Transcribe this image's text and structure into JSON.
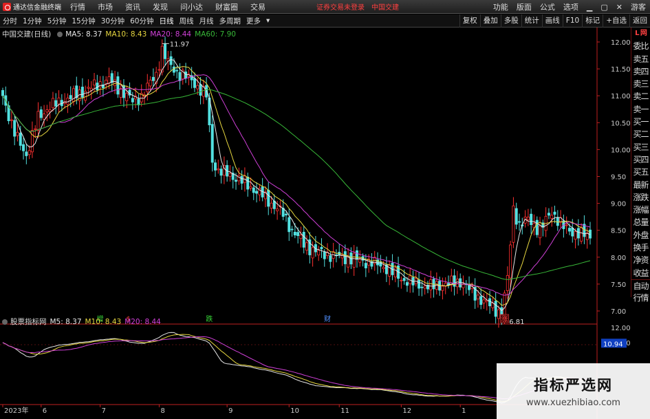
{
  "menubar": {
    "app_name": "通达信金融终端",
    "items": [
      "行情",
      "市场",
      "资讯",
      "发现",
      "问小达",
      "财富圈",
      "交易"
    ],
    "notice": "证券交易未登录",
    "stock": "中国交建",
    "right_items": [
      "功能",
      "版面",
      "公式",
      "选项",
      "游客"
    ]
  },
  "toolbar": {
    "periods": [
      "分时",
      "1分钟",
      "5分钟",
      "15分钟",
      "30分钟",
      "60分钟",
      "日线",
      "周线",
      "月线",
      "多周期",
      "更多"
    ],
    "active_period": "日线",
    "right_items": [
      "复权",
      "叠加",
      "多股",
      "统计",
      "画线",
      "F10",
      "标记",
      "+自选",
      "返回"
    ]
  },
  "legend": {
    "title": "中国交建(日线)",
    "ma5_label": "MA5: 8.37",
    "ma10_label": "MA10: 8.43",
    "ma20_label": "MA20: 8.44",
    "ma60_label": "MA60: 7.90"
  },
  "sub_legend": {
    "title": "股票指标网",
    "m5": "M5: 8.37",
    "m10": "M10: 8.43",
    "m20": "M20: 8.44"
  },
  "right_panel": [
    "L 网",
    "委比",
    "卖五",
    "卖四",
    "卖三",
    "卖二",
    "卖一",
    "买一",
    "买二",
    "买三",
    "买四",
    "买五",
    "最新",
    "涨跌",
    "涨幅",
    "总量",
    "外盘",
    "换手",
    "净资",
    "收益",
    "自动",
    "行情"
  ],
  "watermark": {
    "cn": "指标严选网",
    "url": "www.xuezhibiao.com"
  },
  "colors": {
    "up": "#ff3030",
    "down": "#52e0e0",
    "ma5": "#e8e8e8",
    "ma10": "#e8d840",
    "ma20": "#d040d8",
    "ma60": "#38b838",
    "axis": "#c02020"
  },
  "chart_data": {
    "type": "candlestick",
    "y_ticks": [
      "12.00",
      "11.50",
      "11.00",
      "10.50",
      "10.00",
      "9.50",
      "9.00",
      "8.50",
      "8.00",
      "7.50",
      "7.00"
    ],
    "sub_y_ticks": [
      "12.00",
      "11.00"
    ],
    "sub_value_box": "10.94",
    "x_labels": [
      {
        "text": "2023年",
        "i": 0
      },
      {
        "text": "6",
        "i": 13
      },
      {
        "text": "7",
        "i": 33
      },
      {
        "text": "8",
        "i": 53
      },
      {
        "text": "9",
        "i": 76
      },
      {
        "text": "10",
        "i": 97
      },
      {
        "text": "11",
        "i": 114
      },
      {
        "text": "12",
        "i": 135
      },
      {
        "text": "1",
        "i": 155
      }
    ],
    "annotations": {
      "high": "11.97",
      "low": "6.81"
    },
    "event_marks": [
      {
        "text": "增",
        "i": 33,
        "color": "#38d838"
      },
      {
        "text": "$",
        "i": 43,
        "color": "#ff4040"
      },
      {
        "text": "跌",
        "i": 70,
        "color": "#38d838"
      },
      {
        "text": "财",
        "i": 110,
        "color": "#5090ff"
      },
      {
        "text": "涨",
        "i": 170,
        "color": "#ff4040",
        "boxed": true
      }
    ],
    "anchors": [
      [
        0,
        11.0
      ],
      [
        4,
        10.3
      ],
      [
        8,
        9.9
      ],
      [
        12,
        10.6
      ],
      [
        16,
        10.8
      ],
      [
        20,
        10.9
      ],
      [
        24,
        11.0
      ],
      [
        28,
        11.1
      ],
      [
        32,
        11.2
      ],
      [
        36,
        11.3
      ],
      [
        40,
        11.1
      ],
      [
        44,
        10.9
      ],
      [
        47,
        11.0
      ],
      [
        52,
        11.4
      ],
      [
        54,
        11.85
      ],
      [
        56,
        11.6
      ],
      [
        60,
        11.4
      ],
      [
        64,
        11.3
      ],
      [
        67,
        11.1
      ],
      [
        69,
        11.0
      ],
      [
        71,
        9.8
      ],
      [
        73,
        9.6
      ],
      [
        76,
        9.55
      ],
      [
        80,
        9.45
      ],
      [
        84,
        9.3
      ],
      [
        88,
        9.15
      ],
      [
        92,
        8.95
      ],
      [
        95,
        8.8
      ],
      [
        98,
        8.5
      ],
      [
        102,
        8.25
      ],
      [
        106,
        8.1
      ],
      [
        110,
        8.05
      ],
      [
        115,
        8.0
      ],
      [
        120,
        7.95
      ],
      [
        125,
        7.9
      ],
      [
        130,
        7.8
      ],
      [
        135,
        7.6
      ],
      [
        140,
        7.5
      ],
      [
        145,
        7.45
      ],
      [
        150,
        7.5
      ],
      [
        155,
        7.55
      ],
      [
        160,
        7.3
      ],
      [
        165,
        7.1
      ],
      [
        169,
        6.95
      ],
      [
        171,
        7.6
      ],
      [
        173,
        8.9
      ],
      [
        175,
        8.6
      ],
      [
        178,
        8.7
      ],
      [
        182,
        8.5
      ],
      [
        186,
        8.85
      ],
      [
        190,
        8.55
      ],
      [
        194,
        8.45
      ],
      [
        198,
        8.4
      ]
    ]
  }
}
